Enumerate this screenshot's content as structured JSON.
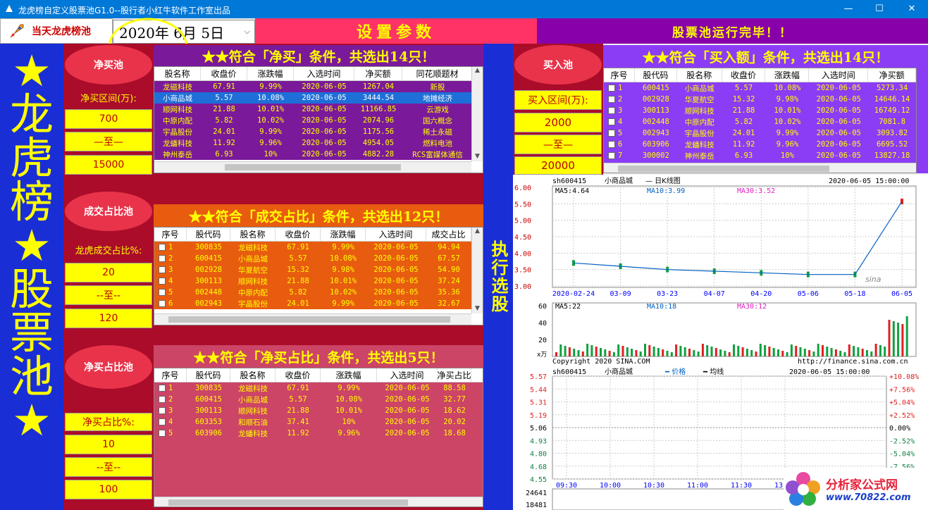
{
  "window": {
    "title": "龙虎榜自定义股票池G1.0--股行者小红牛软件工作室出品"
  },
  "toolbar": {
    "today_button": "当天龙虎榜池",
    "date_value": "2020年 6月 5日",
    "settings_title": "设置参数",
    "status": "股票池运行完毕！！"
  },
  "side_banner": [
    "★",
    "龙",
    "虎",
    "榜",
    "★",
    "股",
    "票",
    "池",
    "★"
  ],
  "execute_button": "执行选股",
  "net_buy": {
    "pool_button": "净买池",
    "range_label": "净买区间(万):",
    "min": "700",
    "to": "—至—",
    "max": "15000",
    "caption": "★★符合「净买」条件，共选出14只！",
    "columns": [
      "股名称",
      "收盘价",
      "涨跌幅",
      "入选时间",
      "净买额",
      "同花顺题材"
    ],
    "rows": [
      [
        "龙磁科技",
        "67.91",
        "9.99%",
        "2020-06-05",
        "1267.04",
        "新股"
      ],
      [
        "小商品城",
        "5.57",
        "10.08%",
        "2020-06-05",
        "3444.54",
        "地摊经济"
      ],
      [
        "顺网科技",
        "21.88",
        "10.01%",
        "2020-06-05",
        "11166.85",
        "云游戏"
      ],
      [
        "中原内配",
        "5.82",
        "10.02%",
        "2020-06-05",
        "2074.96",
        "国六概念"
      ],
      [
        "宇晶股份",
        "24.01",
        "9.99%",
        "2020-06-05",
        "1175.56",
        "稀土永磁"
      ],
      [
        "龙蟠科技",
        "11.92",
        "9.96%",
        "2020-06-05",
        "4954.05",
        "燃料电池"
      ],
      [
        "神州泰岳",
        "6.93",
        "10%",
        "2020-06-05",
        "4882.28",
        "RCS富媒体通信"
      ]
    ]
  },
  "turnover": {
    "pool_button": "成交占比池",
    "range_label": "龙虎成交占比%:",
    "min": "20",
    "to": "--至--",
    "max": "120",
    "caption": "★★符合「成交占比」条件，共选出12只！",
    "columns": [
      "序号",
      "股代码",
      "股名称",
      "收盘价",
      "涨跌幅",
      "入选时间",
      "成交占比"
    ],
    "rows": [
      [
        "1",
        "300835",
        "龙磁科技",
        "67.91",
        "9.99%",
        "2020-06-05",
        "94.94"
      ],
      [
        "2",
        "600415",
        "小商品城",
        "5.57",
        "10.08%",
        "2020-06-05",
        "67.57"
      ],
      [
        "3",
        "002928",
        "华夏航空",
        "15.32",
        "9.98%",
        "2020-06-05",
        "54.90"
      ],
      [
        "4",
        "300113",
        "顺网科技",
        "21.88",
        "10.01%",
        "2020-06-05",
        "37.24"
      ],
      [
        "5",
        "002448",
        "中原内配",
        "5.82",
        "10.02%",
        "2020-06-05",
        "35.36"
      ],
      [
        "6",
        "002943",
        "宇晶股份",
        "24.01",
        "9.99%",
        "2020-06-05",
        "32.67"
      ]
    ]
  },
  "net_ratio": {
    "pool_button": "净买占比池",
    "range_label": "净买占比%:",
    "min": "10",
    "to": "--至--",
    "max": "100",
    "caption": "★★符合「净买占比」条件，共选出5只！",
    "columns": [
      "序号",
      "股代码",
      "股名称",
      "收盘价",
      "涨跌幅",
      "入选时间",
      "净买占比"
    ],
    "rows": [
      [
        "1",
        "300835",
        "龙磁科技",
        "67.91",
        "9.99%",
        "2020-06-05",
        "88.58"
      ],
      [
        "2",
        "600415",
        "小商品城",
        "5.57",
        "10.08%",
        "2020-06-05",
        "32.77"
      ],
      [
        "3",
        "300113",
        "顺网科技",
        "21.88",
        "10.01%",
        "2020-06-05",
        "18.62"
      ],
      [
        "4",
        "603353",
        "和顺石油",
        "37.41",
        "10%",
        "2020-06-05",
        "20.02"
      ],
      [
        "5",
        "603906",
        "龙蟠科技",
        "11.92",
        "9.96%",
        "2020-06-05",
        "18.68"
      ]
    ]
  },
  "buy_pool": {
    "pool_button": "买入池",
    "range_label": "买入区间(万):",
    "min": "2000",
    "to": "—至—",
    "max": "20000",
    "caption": "★★符合「买入额」条件，共选出14只！",
    "columns": [
      "序号",
      "股代码",
      "股名称",
      "收盘价",
      "涨跌幅",
      "入选时间",
      "净买额"
    ],
    "rows": [
      [
        "1",
        "600415",
        "小商品城",
        "5.57",
        "10.08%",
        "2020-06-05",
        "5273.34"
      ],
      [
        "2",
        "002928",
        "华夏航空",
        "15.32",
        "9.98%",
        "2020-06-05",
        "14646.14"
      ],
      [
        "3",
        "300113",
        "顺网科技",
        "21.88",
        "10.01%",
        "2020-06-05",
        "16749.12"
      ],
      [
        "4",
        "002448",
        "中原内配",
        "5.82",
        "10.02%",
        "2020-06-05",
        "7081.8"
      ],
      [
        "5",
        "002943",
        "宇晶股份",
        "24.01",
        "9.99%",
        "2020-06-05",
        "3093.82"
      ],
      [
        "6",
        "603906",
        "龙蟠科技",
        "11.92",
        "9.96%",
        "2020-06-05",
        "6695.52"
      ],
      [
        "7",
        "300002",
        "神州泰岳",
        "6.93",
        "10%",
        "2020-06-05",
        "13827.18"
      ]
    ]
  },
  "kline": {
    "code": "sh600415",
    "name": "小商品城",
    "kind": "— 日K线图",
    "datetime": "2020-06-05 15:00:00",
    "ma5": "MA5:4.64",
    "ma10": "MA10:3.99",
    "ma30": "MA30:3.52",
    "y_ticks": [
      "6.00",
      "5.50",
      "5.00",
      "4.50",
      "4.00",
      "3.50",
      "3.00"
    ],
    "x_ticks": [
      "2020-02-24",
      "03-09",
      "03-23",
      "04-07",
      "04-20",
      "05-06",
      "05-18",
      "06-05"
    ],
    "vol_ma5": "MA5:22",
    "vol_ma10": "MA10:18",
    "vol_ma30": "MA30:12",
    "vol_ticks": [
      "60",
      "40",
      "20"
    ],
    "vol_unit": "x万",
    "copyright": "Copyright 2020 SINA.COM",
    "url": "http://finance.sina.com.cn",
    "brand": "sina"
  },
  "intraday": {
    "code": "sh600415",
    "name": "小商品城",
    "legend_price": "价格",
    "legend_avg": "均线",
    "datetime": "2020-06-05 15:00:00",
    "left_ticks": [
      "5.57",
      "5.44",
      "5.31",
      "5.19",
      "5.06",
      "4.93",
      "4.80",
      "4.68",
      "4.55"
    ],
    "right_ticks": [
      "+10.08%",
      "+7.56%",
      "+5.04%",
      "+2.52%",
      "0.00%",
      "-2.52%",
      "-5.04%",
      "-7.56%"
    ],
    "x_ticks": [
      "09:30",
      "10:00",
      "10:30",
      "11:00",
      "11:30",
      "13:30"
    ],
    "vol_ticks": [
      "24641",
      "18481"
    ]
  },
  "watermark": {
    "name": "分析家公式网",
    "url": "www.70822.com"
  },
  "chart_data": {
    "type": "bar",
    "title": "",
    "categories": [
      "2020-02-24",
      "03-09",
      "03-23",
      "04-07",
      "04-20",
      "05-06",
      "05-18",
      "06-05"
    ],
    "series": [
      {
        "values": [
          3.7,
          3.6,
          3.5,
          3.45,
          3.4,
          3.35,
          3.35,
          5.57
        ]
      }
    ],
    "ylim": [
      3.0,
      6.0
    ]
  }
}
